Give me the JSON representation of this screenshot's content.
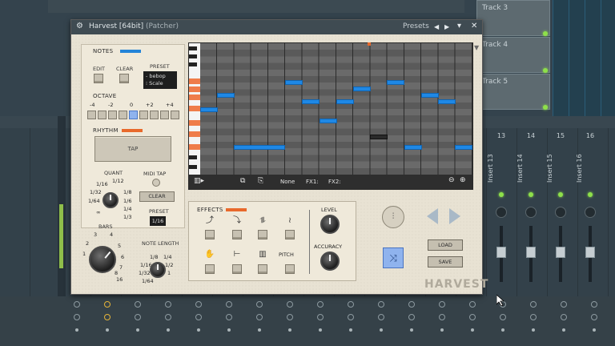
{
  "background": {
    "tracks": [
      {
        "label": "Track 3"
      },
      {
        "label": "Track 4"
      },
      {
        "label": "Track 5"
      }
    ],
    "inserts": [
      {
        "num": "13",
        "label": "Insert 13"
      },
      {
        "num": "14",
        "label": "Insert 14"
      },
      {
        "num": "15",
        "label": "Insert 15"
      },
      {
        "num": "16",
        "label": "Insert 16"
      }
    ]
  },
  "window": {
    "title": "Harvest [64bit]",
    "subtitle": "(Patcher)",
    "presets_label": "Presets",
    "prev": "◀",
    "next": "▶",
    "close": "✕"
  },
  "notes": {
    "label": "NOTES",
    "edit": "EDIT",
    "clear": "CLEAR",
    "preset_label": "PRESET",
    "preset_line1": "bebop",
    "preset_line2": "Scale",
    "octave_label": "OCTAVE",
    "octave_values": [
      "-4",
      "-2",
      "0",
      "+2",
      "+4"
    ],
    "octave_selected_index": 4
  },
  "rhythm": {
    "label": "RHYTHM",
    "tap": "TAP",
    "quant_label": "QUANT",
    "quant_values": [
      "1/16",
      "1/12",
      "1/32",
      "1/8",
      "1/64",
      "1/6",
      "1/4",
      "1/3",
      "∞"
    ],
    "midi_tap": "MIDI TAP",
    "clear": "CLEAR",
    "preset_label": "PRESET",
    "preset_value": "1/16"
  },
  "bars": {
    "label": "BARS",
    "values": [
      "3",
      "4",
      "2",
      "5",
      "1",
      "6",
      "7",
      "8",
      "16"
    ],
    "note_length_label": "NOTE LENGTH",
    "note_length_values": [
      "1/8",
      "1/4",
      "1/16",
      "1/2",
      "1/32",
      "1",
      "1/64"
    ]
  },
  "roll": {
    "toolbar": {
      "fx_none": "None",
      "fx1": "FX1:",
      "fx2": "FX2:"
    }
  },
  "effects": {
    "label": "EFFECTS",
    "pitch": "PITCH",
    "level": "LEVEL",
    "accuracy": "ACCURACY"
  },
  "side": {
    "load": "LOAD",
    "save": "SAVE",
    "logo": "HARVEST"
  },
  "colors": {
    "note_blue": "#1f88e5",
    "accent_orange": "#e8692b",
    "rand_blue": "#8fb3ee"
  }
}
